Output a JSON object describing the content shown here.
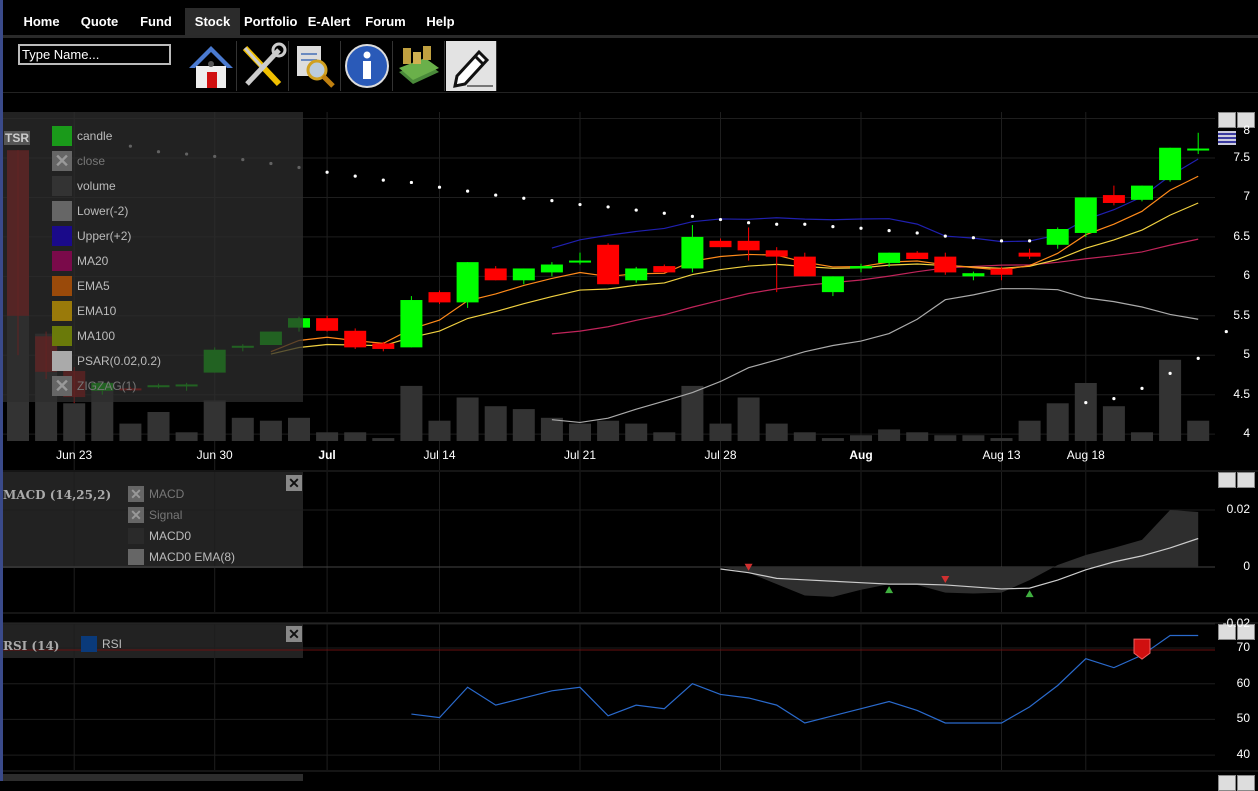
{
  "nav": {
    "tabs": [
      {
        "label": "Home"
      },
      {
        "label": "Quote"
      },
      {
        "label": "Fund"
      },
      {
        "label": "Stock",
        "active": true
      },
      {
        "label": "Portfolio"
      },
      {
        "label": "E-Alert"
      },
      {
        "label": "Forum"
      },
      {
        "label": "Help"
      }
    ]
  },
  "toolbar": {
    "search_placeholder": "Type Name...",
    "icons": [
      "home-icon",
      "tools-icon",
      "document-search-icon",
      "info-icon",
      "money-icon",
      "pencil-icon"
    ],
    "selected": "pencil-icon"
  },
  "main_panel": {
    "symbol": "TSR",
    "legend": [
      {
        "label": "candle",
        "color": "#1a9a1a",
        "hidden": false
      },
      {
        "label": "close",
        "color": "#666",
        "hidden": true
      },
      {
        "label": "volume",
        "color": "#333",
        "hidden": false
      },
      {
        "label": "Lower(-2)",
        "color": "#666",
        "hidden": false
      },
      {
        "label": "Upper(+2)",
        "color": "#1a0a8a",
        "hidden": false
      },
      {
        "label": "MA20",
        "color": "#7a0a4a",
        "hidden": false
      },
      {
        "label": "EMA5",
        "color": "#9a4a0a",
        "hidden": false
      },
      {
        "label": "EMA10",
        "color": "#9a7a0a",
        "hidden": false
      },
      {
        "label": "MA100",
        "color": "#6a7a0a",
        "hidden": false
      },
      {
        "label": "PSAR(0.02,0.2)",
        "color": "#aaa",
        "hidden": false
      },
      {
        "label": "ZIGZAG(1)",
        "color": "#666",
        "hidden": true
      }
    ],
    "y_ticks": [
      "8",
      "7.5",
      "7",
      "6.5",
      "6",
      "5.5",
      "5",
      "4.5",
      "4"
    ],
    "x_labels": [
      {
        "label": "Jun 23",
        "i": 2
      },
      {
        "label": "Jun 30",
        "i": 7
      },
      {
        "label": "Jul",
        "i": 11,
        "bold": true
      },
      {
        "label": "Jul 14",
        "i": 15
      },
      {
        "label": "Jul 21",
        "i": 20
      },
      {
        "label": "Jul 28",
        "i": 25
      },
      {
        "label": "Aug",
        "i": 30,
        "bold": true
      },
      {
        "label": "Aug 13",
        "i": 35
      },
      {
        "label": "Aug 18",
        "i": 38
      }
    ]
  },
  "chart_data": {
    "type": "candlestick",
    "ylim": [
      3.9,
      8.1
    ],
    "candles": [
      [
        7.6,
        7.6,
        5.0,
        5.5
      ],
      [
        5.24,
        5.3,
        4.7,
        4.79
      ],
      [
        4.8,
        4.85,
        4.4,
        4.47
      ],
      [
        4.55,
        4.65,
        4.5,
        4.65
      ],
      [
        4.58,
        4.6,
        4.55,
        4.56
      ],
      [
        4.6,
        4.64,
        4.58,
        4.62
      ],
      [
        4.61,
        4.65,
        4.55,
        4.63
      ],
      [
        4.78,
        5.1,
        4.78,
        5.07
      ],
      [
        5.1,
        5.14,
        5.05,
        5.12
      ],
      [
        5.13,
        5.3,
        5.13,
        5.3
      ],
      [
        5.35,
        5.49,
        5.3,
        5.47
      ],
      [
        5.47,
        5.5,
        5.3,
        5.31
      ],
      [
        5.31,
        5.34,
        5.08,
        5.1
      ],
      [
        5.15,
        5.17,
        5.05,
        5.08
      ],
      [
        5.1,
        5.75,
        5.1,
        5.7
      ],
      [
        5.8,
        5.82,
        5.65,
        5.67
      ],
      [
        5.67,
        6.18,
        5.6,
        6.18
      ],
      [
        6.1,
        6.13,
        5.95,
        5.95
      ],
      [
        5.95,
        6.1,
        5.9,
        6.1
      ],
      [
        6.05,
        6.18,
        6.0,
        6.15
      ],
      [
        6.18,
        6.3,
        6.15,
        6.2
      ],
      [
        6.4,
        6.42,
        5.9,
        5.9
      ],
      [
        5.95,
        6.12,
        5.92,
        6.1
      ],
      [
        6.13,
        6.15,
        6.05,
        6.05
      ],
      [
        6.1,
        6.65,
        6.05,
        6.5
      ],
      [
        6.45,
        6.48,
        6.37,
        6.37
      ],
      [
        6.45,
        6.62,
        6.2,
        6.33
      ],
      [
        6.33,
        6.37,
        5.8,
        6.25
      ],
      [
        6.25,
        6.3,
        6.0,
        6.0
      ],
      [
        5.8,
        6.0,
        5.75,
        6.0
      ],
      [
        6.1,
        6.16,
        6.05,
        6.13
      ],
      [
        6.17,
        6.3,
        6.12,
        6.3
      ],
      [
        6.3,
        6.32,
        6.22,
        6.22
      ],
      [
        6.25,
        6.3,
        6.02,
        6.05
      ],
      [
        6.0,
        6.06,
        5.95,
        6.04
      ],
      [
        6.1,
        6.12,
        5.95,
        6.02
      ],
      [
        6.3,
        6.35,
        6.22,
        6.25
      ],
      [
        6.4,
        6.62,
        6.35,
        6.6
      ],
      [
        6.55,
        7.0,
        6.5,
        7.0
      ],
      [
        7.03,
        7.15,
        6.9,
        6.93
      ],
      [
        6.97,
        7.15,
        6.95,
        7.15
      ],
      [
        7.22,
        7.63,
        7.2,
        7.63
      ],
      [
        7.62,
        7.82,
        7.55,
        7.62
      ]
    ],
    "volume_pct": [
      100,
      37,
      13,
      19,
      6,
      10,
      3,
      14,
      8,
      7,
      8,
      3,
      3,
      1,
      19,
      7,
      15,
      12,
      11,
      8,
      6,
      7,
      6,
      3,
      19,
      6,
      15,
      6,
      3,
      1,
      2,
      4,
      3,
      2,
      2,
      1,
      7,
      13,
      20,
      12,
      3,
      28,
      7
    ],
    "psar": [
      null,
      null,
      null,
      null,
      7.65,
      7.58,
      7.55,
      7.52,
      7.48,
      7.43,
      7.38,
      7.32,
      7.27,
      7.22,
      7.19,
      7.13,
      7.08,
      7.03,
      6.99,
      6.96,
      6.91,
      6.88,
      6.84,
      6.8,
      6.76,
      6.72,
      6.68,
      6.66,
      6.66,
      6.63,
      6.61,
      6.58,
      6.55,
      6.51,
      6.49,
      6.45,
      6.45,
      null,
      4.4,
      4.45,
      4.58,
      4.77,
      4.96,
      5.3
    ],
    "macd": {
      "ylim": [
        -0.026,
        0.028
      ],
      "y_ticks": [
        "0.02",
        "0",
        "-0.02"
      ],
      "start_index": 25,
      "macd0": [
        0,
        -0.002,
        -0.006,
        -0.01,
        -0.0105,
        -0.008,
        -0.006,
        -0.0063,
        -0.009,
        -0.0093,
        -0.009,
        -0.0046,
        0.0007,
        0.0042,
        0.0067,
        0.0095,
        0.02,
        0.0193
      ],
      "macd0_ema": [
        -0.0007,
        -0.002,
        -0.004,
        -0.0045,
        -0.005,
        -0.0055,
        -0.006,
        -0.006,
        -0.0063,
        -0.007,
        -0.0077,
        -0.0074,
        -0.0046,
        -0.001,
        0.0018,
        0.0039,
        0.0067,
        0.01
      ],
      "sell_markers": [
        26,
        33
      ],
      "buy_markers": [
        31,
        36
      ]
    },
    "rsi": {
      "ylim": [
        36,
        76
      ],
      "y_ticks": [
        "70",
        "60",
        "50",
        "40"
      ],
      "start_index": 14,
      "values": [
        51.5,
        50.5,
        59,
        54,
        56,
        58,
        59,
        51,
        54,
        53,
        60,
        57,
        56,
        54,
        49,
        51,
        53,
        55,
        52.5,
        49,
        49,
        49,
        53.5,
        59.5,
        67,
        64.5,
        68,
        73.5,
        73.5
      ],
      "overbought": 70,
      "sell_markers": [
        40
      ]
    }
  },
  "macd_panel": {
    "title": "MACD (14,25,2)",
    "legend": [
      {
        "label": "MACD",
        "hidden": true
      },
      {
        "label": "Signal",
        "hidden": true
      },
      {
        "label": "MACD0",
        "color": "#2a2a2a"
      },
      {
        "label": "MACD0 EMA(8)",
        "color": "#666"
      }
    ],
    "close": "✕"
  },
  "rsi_panel": {
    "title": "RSI (14)",
    "legend": [
      {
        "label": "RSI",
        "color": "#0a3a7a"
      }
    ],
    "close": "✕"
  },
  "colors": {
    "up": "#00ff00",
    "down": "#ff0000",
    "upper": "#2020b0",
    "lower": "#aaa",
    "ma20": "#c0245a",
    "ema5": "#ff8a1a",
    "ema10": "#f0d040",
    "rsi": "#2a6acc"
  }
}
